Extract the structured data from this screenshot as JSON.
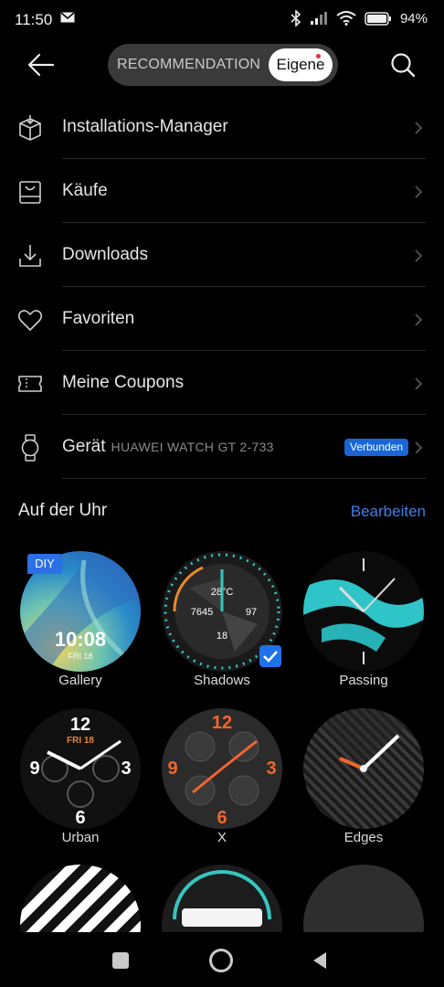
{
  "status": {
    "time": "11:50",
    "battery": "94"
  },
  "header": {
    "tab_recommendation": "RECOMMENDATION",
    "tab_own": "Eigene"
  },
  "menu": [
    {
      "label": "Installations-Manager"
    },
    {
      "label": "Käufe"
    },
    {
      "label": "Downloads"
    },
    {
      "label": "Favoriten"
    },
    {
      "label": "Meine Coupons"
    },
    {
      "label": "Gerät",
      "sub": "HUAWEI WATCH GT 2-733",
      "badge": "Verbunden"
    }
  ],
  "section": {
    "title": "Auf der Uhr",
    "action": "Bearbeiten"
  },
  "faces": [
    {
      "name": "Gallery",
      "tag": "DIY",
      "time": "10:08",
      "date": "FRI 18"
    },
    {
      "name": "Shadows",
      "selected": true
    },
    {
      "name": "Passing"
    },
    {
      "name": "Urban",
      "date": "FRI 18"
    },
    {
      "name": "X"
    },
    {
      "name": "Edges"
    }
  ],
  "colors": {
    "accent": "#3f7de8",
    "badge": "#1a66d6"
  }
}
